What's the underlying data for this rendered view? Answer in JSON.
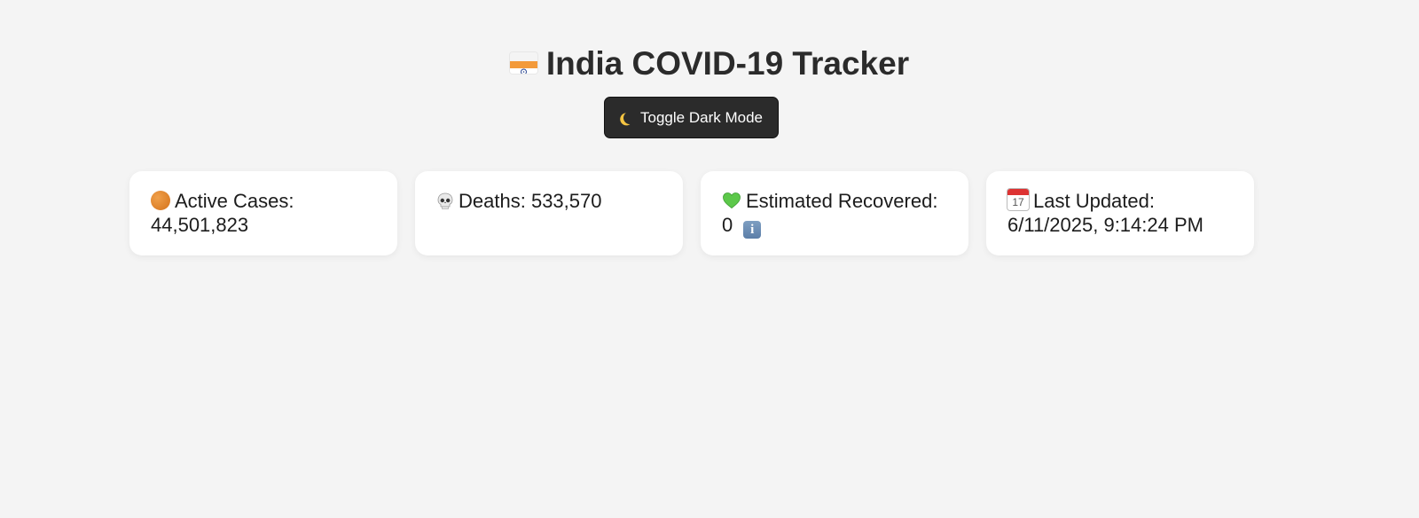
{
  "header": {
    "title": "India COVID-19 Tracker",
    "flag_icon": "india-flag-icon"
  },
  "toggle_button": {
    "label": "Toggle Dark Mode",
    "icon": "moon-icon"
  },
  "stats": {
    "active": {
      "label": "Active Cases:",
      "value": "44,501,823",
      "icon": "orange-circle-icon"
    },
    "deaths": {
      "label": "Deaths:",
      "value": "533,570",
      "icon": "skull-icon"
    },
    "recovered": {
      "label": "Estimated Recovered:",
      "value": "0",
      "icon": "green-heart-icon",
      "info_icon": "info-icon"
    },
    "updated": {
      "label": "Last Updated:",
      "value": "6/11/2025, 9:14:24 PM",
      "icon": "calendar-icon",
      "calendar_day": "17"
    }
  },
  "colors": {
    "background": "#f4f4f4",
    "card": "#ffffff",
    "button": "#2b2b2b",
    "title": "#2b2b2b"
  }
}
